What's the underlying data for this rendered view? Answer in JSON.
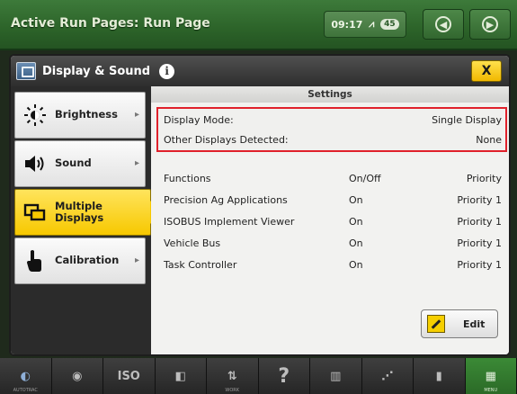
{
  "header": {
    "title": "Active Run Pages: Run Page",
    "time": "09:17",
    "status_pill": "45"
  },
  "dialog": {
    "title": "Display & Sound",
    "close_label": "X"
  },
  "menu": {
    "items": [
      {
        "label": "Brightness",
        "icon": "brightness-icon"
      },
      {
        "label": "Sound",
        "icon": "speaker-icon"
      },
      {
        "label": "Multiple Displays",
        "icon": "multiple-displays-icon",
        "active": true
      },
      {
        "label": "Calibration",
        "icon": "touch-hand-icon"
      }
    ]
  },
  "settings": {
    "title": "Settings",
    "display_mode_label": "Display Mode:",
    "display_mode_value": "Single Display",
    "other_displays_label": "Other Displays Detected:",
    "other_displays_value": "None",
    "table": {
      "headers": [
        "Functions",
        "On/Off",
        "Priority"
      ],
      "rows": [
        [
          "Precision Ag Applications",
          "On",
          "Priority 1"
        ],
        [
          "ISOBUS Implement Viewer",
          "On",
          "Priority 1"
        ],
        [
          "Vehicle Bus",
          "On",
          "Priority 1"
        ],
        [
          "Task Controller",
          "On",
          "Priority 1"
        ]
      ]
    },
    "edit_label": "Edit"
  },
  "toolbar": {
    "tools": [
      {
        "label": "AUTOTRAC",
        "icon": "autotrac-icon"
      },
      {
        "label": "",
        "icon": "target-icon"
      },
      {
        "label": "ISO",
        "icon": "iso-icon"
      },
      {
        "label": "",
        "icon": "display-sound-icon"
      },
      {
        "label": "WORK",
        "icon": "work-icon"
      },
      {
        "label": "?",
        "icon": "help-icon"
      },
      {
        "label": "",
        "icon": "bars-icon"
      },
      {
        "label": "",
        "icon": "ag-icon"
      },
      {
        "label": "",
        "icon": "apps-icon"
      },
      {
        "label": "MENU",
        "icon": "menu-grid-icon"
      }
    ]
  },
  "colors": {
    "header_green": "#2c6329",
    "active_yellow": "#f7c800",
    "highlight_red": "#e0212b"
  }
}
